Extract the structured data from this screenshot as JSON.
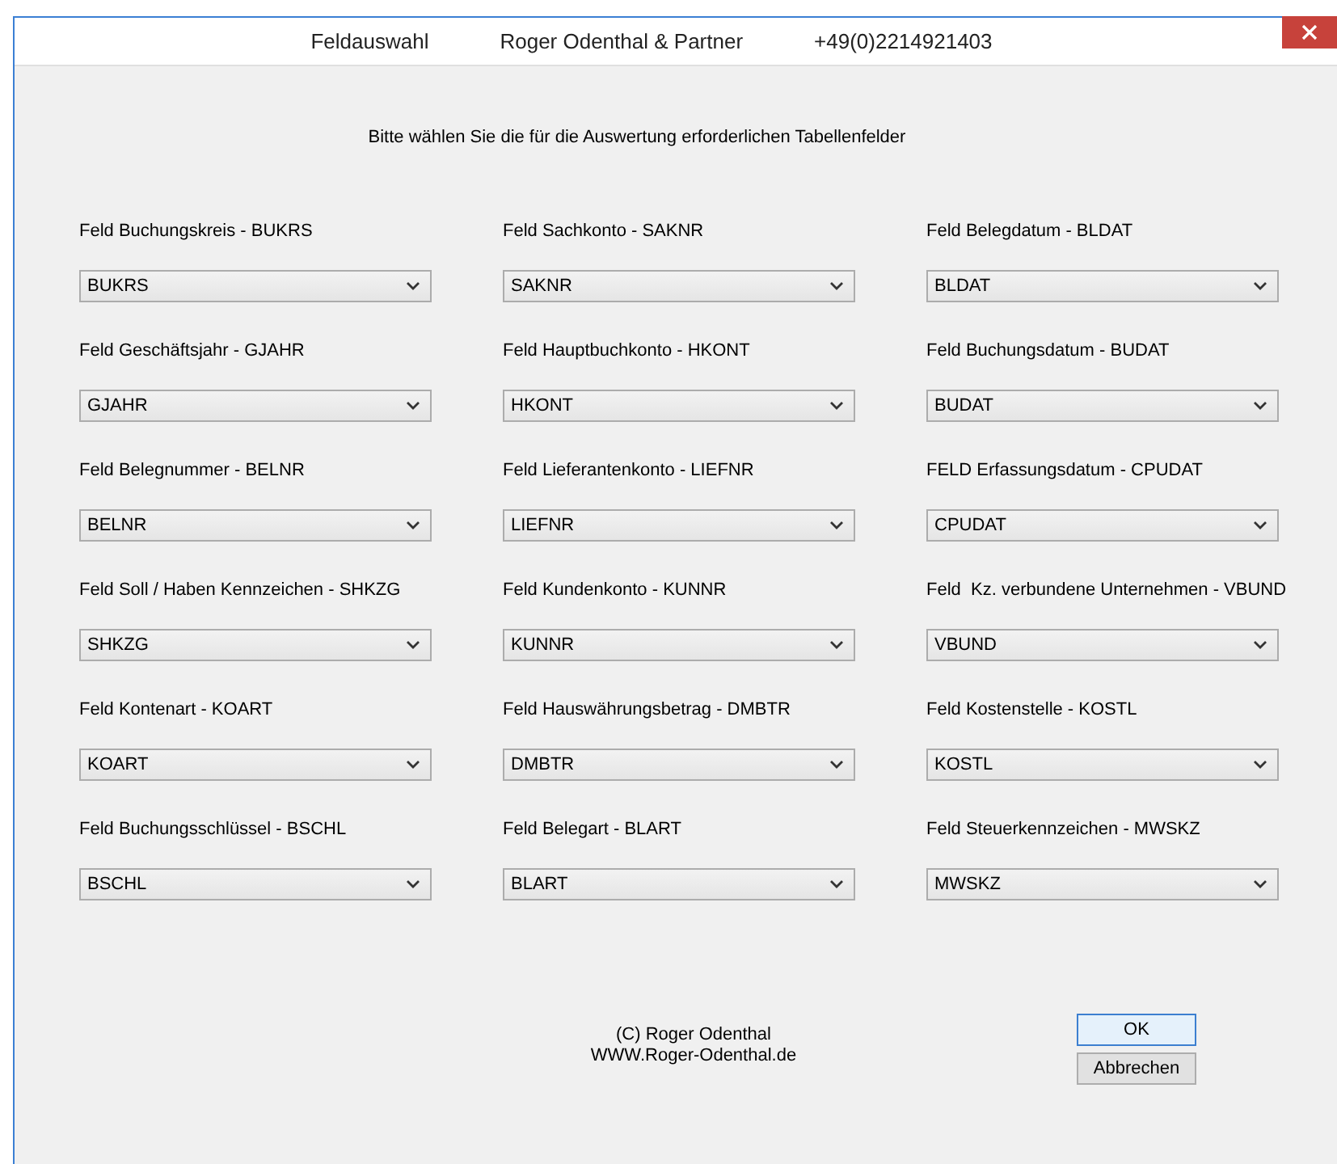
{
  "window": {
    "title_parts": [
      "Feldauswahl",
      "Roger Odenthal & Partner",
      "+49(0)2214921403"
    ]
  },
  "instruction": "Bitte wählen Sie die für die Auswertung erforderlichen Tabellenfelder",
  "fields": [
    {
      "label": "Feld Buchungskreis - BUKRS",
      "value": "BUKRS"
    },
    {
      "label": "Feld Sachkonto - SAKNR",
      "value": "SAKNR"
    },
    {
      "label": "Feld Belegdatum - BLDAT",
      "value": "BLDAT"
    },
    {
      "label": "Feld Geschäftsjahr - GJAHR",
      "value": "GJAHR"
    },
    {
      "label": "Feld Hauptbuchkonto - HKONT",
      "value": "HKONT"
    },
    {
      "label": "Feld Buchungsdatum - BUDAT",
      "value": "BUDAT"
    },
    {
      "label": "Feld Belegnummer - BELNR",
      "value": "BELNR"
    },
    {
      "label": "Feld Lieferantenkonto - LIEFNR",
      "value": "LIEFNR"
    },
    {
      "label": "FELD Erfassungsdatum - CPUDAT",
      "value": "CPUDAT"
    },
    {
      "label": "Feld Soll / Haben Kennzeichen - SHKZG",
      "value": "SHKZG"
    },
    {
      "label": "Feld Kundenkonto - KUNNR",
      "value": "KUNNR"
    },
    {
      "label": "Feld  Kz. verbundene Unternehmen - VBUND",
      "value": "VBUND"
    },
    {
      "label": "Feld Kontenart - KOART",
      "value": "KOART"
    },
    {
      "label": "Feld Hauswährungsbetrag - DMBTR",
      "value": "DMBTR"
    },
    {
      "label": "Feld Kostenstelle - KOSTL",
      "value": "KOSTL"
    },
    {
      "label": "Feld Buchungsschlüssel - BSCHL",
      "value": "BSCHL"
    },
    {
      "label": "Feld Belegart - BLART",
      "value": "BLART"
    },
    {
      "label": "Feld Steuerkennzeichen - MWSKZ",
      "value": "MWSKZ"
    }
  ],
  "copyright": [
    "(C) Roger Odenthal",
    "WWW.Roger-Odenthal.de"
  ],
  "buttons": [
    {
      "label": "OK",
      "focused": true
    },
    {
      "label": "Abbrechen",
      "focused": false
    }
  ]
}
